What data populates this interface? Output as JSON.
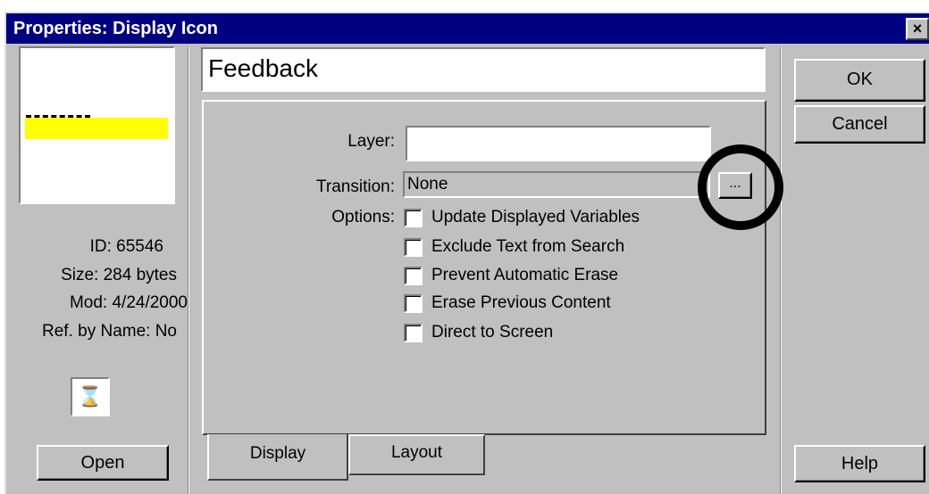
{
  "window": {
    "title": "Properties: Display Icon",
    "close_label": "×"
  },
  "icon_info": {
    "id": "ID: 65546",
    "size": "Size: 284 bytes",
    "modified": "Mod: 4/24/2000",
    "ref_by_name": "Ref. by Name: No",
    "icon_glyph": "⌛"
  },
  "buttons": {
    "open": "Open",
    "ok": "OK",
    "cancel": "Cancel",
    "help": "Help",
    "ellipsis": "..."
  },
  "title_field": {
    "value": "Feedback"
  },
  "form": {
    "layer_label": "Layer:",
    "layer_value": "",
    "transition_label": "Transition:",
    "transition_value": "None",
    "options_label": "Options:"
  },
  "options": [
    {
      "label": "Update Displayed Variables",
      "checked": false
    },
    {
      "label": "Exclude Text from Search",
      "checked": false
    },
    {
      "label": "Prevent Automatic Erase",
      "checked": false
    },
    {
      "label": "Erase Previous Content",
      "checked": false
    },
    {
      "label": "Direct to Screen",
      "checked": false
    }
  ],
  "tabs": [
    {
      "label": "Display",
      "active": true
    },
    {
      "label": "Layout",
      "active": false
    }
  ]
}
